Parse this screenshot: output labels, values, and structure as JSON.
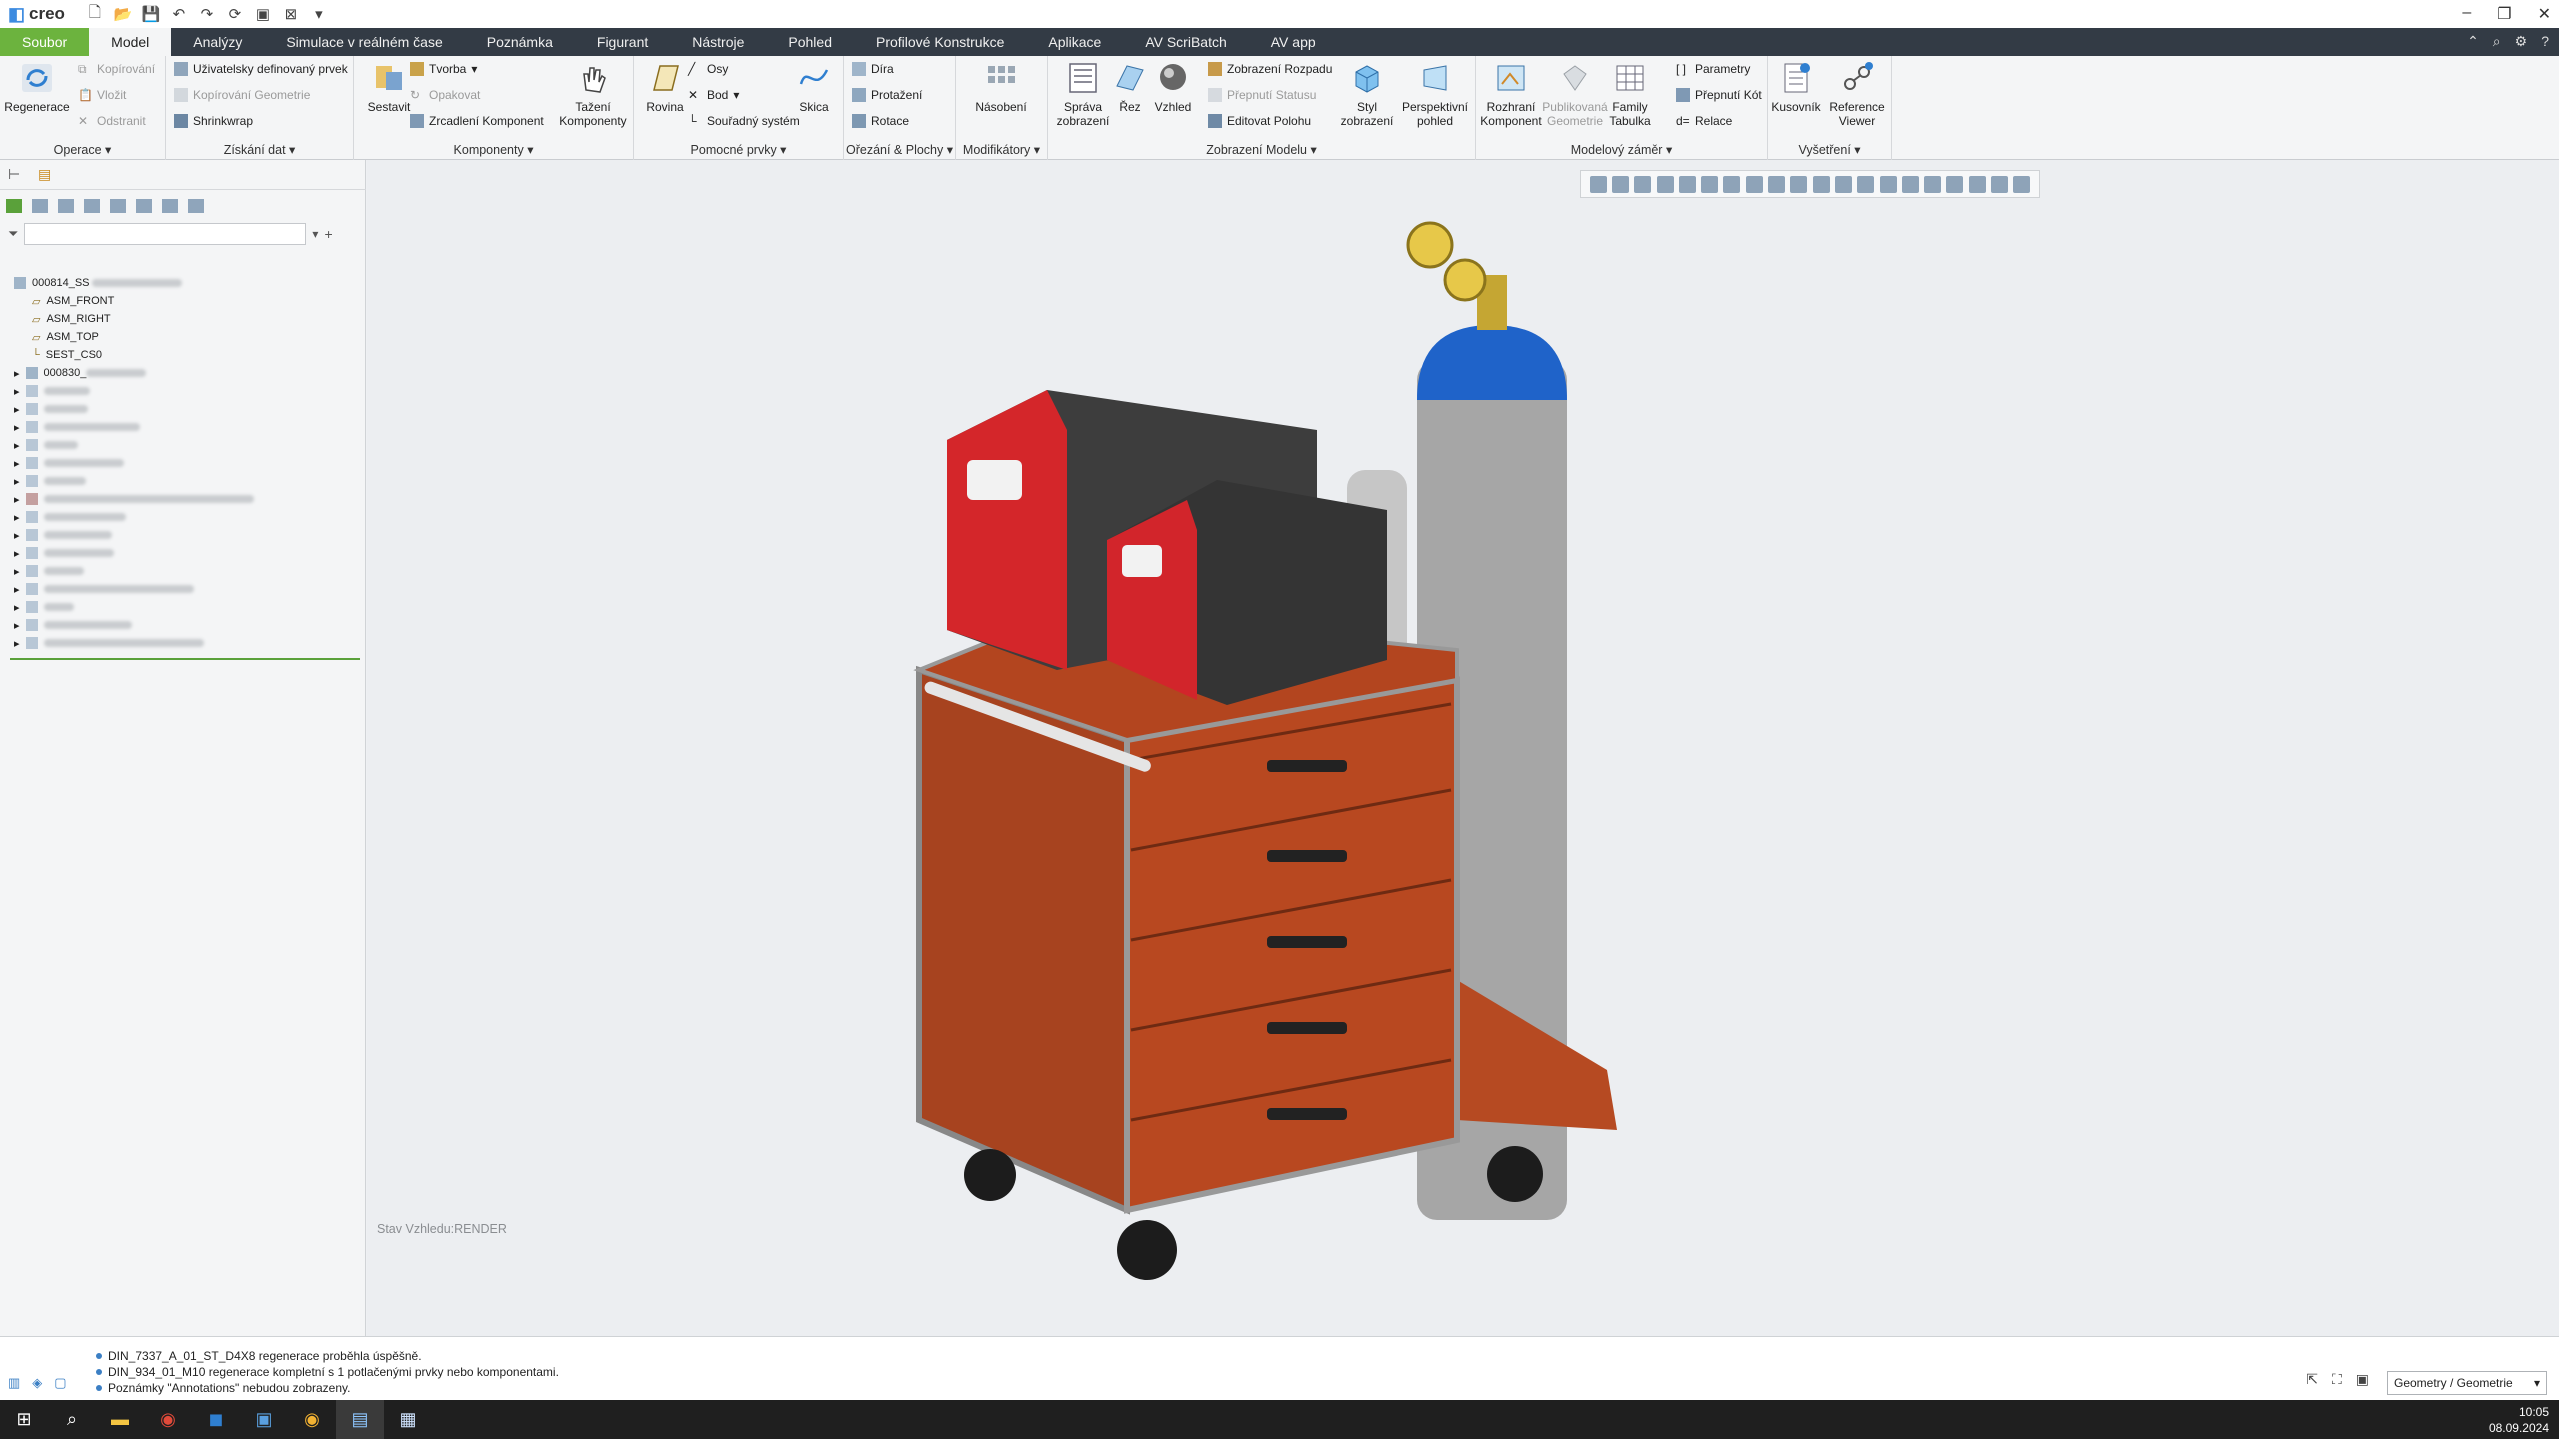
{
  "app": {
    "logo": "creo"
  },
  "tabs": [
    "Soubor",
    "Model",
    "Analýzy",
    "Simulace v reálném čase",
    "Poznámka",
    "Figurant",
    "Nástroje",
    "Pohled",
    "Profilové Konstrukce",
    "Aplikace",
    "AV ScriBatch",
    "AV app"
  ],
  "ribbon": {
    "operace": {
      "label": "Operace ▾",
      "regenerace": "Regenerace",
      "kopirovani": "Kopírování",
      "vlozit": "Vložit",
      "odstranit": "Odstranit"
    },
    "ziskani": {
      "label": "Získání dat ▾",
      "udf": "Uživatelsky definovaný prvek",
      "kopgeom": "Kopírování Geometrie",
      "shrinkwrap": "Shrinkwrap"
    },
    "komponenty": {
      "label": "Komponenty ▾",
      "sestavit": "Sestavit",
      "tvorba": "Tvorba",
      "opakovat": "Opakovat",
      "zrcadleni": "Zrcadlení Komponent",
      "tazeni": "Tažení Komponenty"
    },
    "pomocne": {
      "label": "Pomocné prvky ▾",
      "rovina": "Rovina",
      "osy": "Osy",
      "bod": "Bod",
      "souradny": "Souřadný systém",
      "skica": "Skica"
    },
    "orezani": {
      "label": "Ořezání & Plochy ▾",
      "dira": "Díra",
      "protazeni": "Protažení",
      "rotace": "Rotace"
    },
    "modifikatory": {
      "label": "Modifikátory ▾",
      "nasobeni": "Násobení"
    },
    "zobrazeni": {
      "label": "Zobrazení Modelu ▾",
      "sprava": "Správa zobrazení",
      "rez": "Řez",
      "vzhled": "Vzhled",
      "rozpad": "Zobrazení Rozpadu",
      "statusu": "Přepnutí Statusu",
      "polohu": "Editovat Polohu",
      "styl": "Styl zobrazení",
      "persp": "Perspektivní pohled"
    },
    "modelovy": {
      "label": "Modelový záměr ▾",
      "rozhrani": "Rozhraní Komponent",
      "publikovana": "Publikovaná Geometrie",
      "family": "Family Tabulka",
      "parametry": "Parametry",
      "prepnuti": "Přepnutí Kót",
      "relace": "Relace"
    },
    "vysetreni": {
      "label": "Vyšetření ▾",
      "kusovnik": "Kusovník",
      "refviewer": "Reference Viewer"
    }
  },
  "tree": {
    "root": "000814_SS",
    "items": [
      "ASM_FRONT",
      "ASM_RIGHT",
      "ASM_TOP",
      "SEST_CS0",
      "000830_"
    ]
  },
  "viewport": {
    "status": "Stav Vzhledu:RENDER"
  },
  "messages": [
    "DIN_7337_A_01_ST_D4X8 regenerace proběhla úspěšně.",
    "DIN_934_01_M10 regenerace kompletní s 1 potlačenými prvky nebo komponentami.",
    "Poznámky \"Annotations\" nebudou zobrazeny."
  ],
  "selection_filter": "Geometry / Geometrie",
  "clock": {
    "time": "10:05",
    "date": "08.09.2024"
  }
}
